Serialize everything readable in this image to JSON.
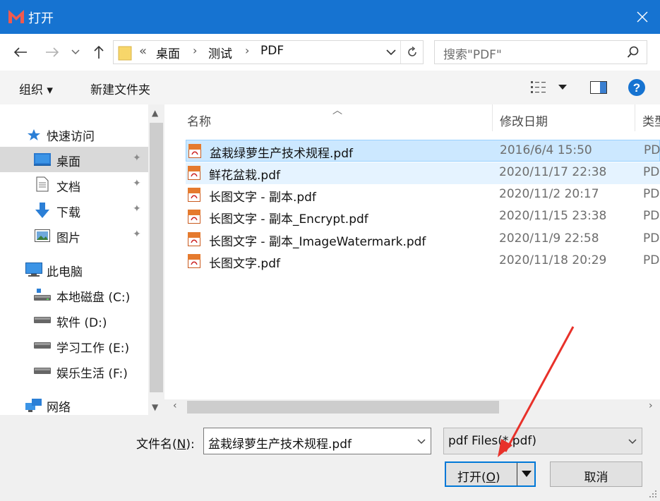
{
  "window": {
    "title": "打开",
    "close_icon": "close-icon"
  },
  "nav": {
    "back_icon": "arrow-left-icon",
    "forward_icon": "arrow-right-icon",
    "recent_icon": "chevron-down-icon",
    "up_icon": "arrow-up-icon",
    "overflow": "«",
    "breadcrumbs": [
      "桌面",
      "测试",
      "PDF"
    ],
    "refresh_icon": "refresh-icon",
    "search_placeholder": "搜索\"PDF\""
  },
  "toolbar": {
    "organize_label": "组织 ▾",
    "new_folder_label": "新建文件夹",
    "view_icon": "view-list-icon",
    "preview_icon": "preview-pane-icon",
    "help_icon": "help-icon"
  },
  "sidebar": {
    "items": [
      {
        "label": "快速访问",
        "icon": "star-icon"
      },
      {
        "label": "桌面",
        "icon": "desktop-icon",
        "pinned": true,
        "selected": true
      },
      {
        "label": "文档",
        "icon": "document-icon",
        "pinned": true
      },
      {
        "label": "下载",
        "icon": "download-icon",
        "pinned": true
      },
      {
        "label": "图片",
        "icon": "picture-icon",
        "pinned": true
      },
      {
        "label": "此电脑",
        "icon": "computer-icon"
      },
      {
        "label": "本地磁盘 (C:)",
        "icon": "drive-c-icon"
      },
      {
        "label": "软件 (D:)",
        "icon": "drive-icon"
      },
      {
        "label": "学习工作 (E:)",
        "icon": "drive-icon"
      },
      {
        "label": "娱乐生活 (F:)",
        "icon": "drive-icon"
      },
      {
        "label": "网络",
        "icon": "network-icon"
      }
    ]
  },
  "files": {
    "columns": [
      "名称",
      "修改日期",
      "类型"
    ],
    "rows": [
      {
        "name": "盆栽绿萝生产技术规程.pdf",
        "date": "2016/6/4 15:50",
        "type": "PD"
      },
      {
        "name": "鲜花盆栽.pdf",
        "date": "2020/11/17 22:38",
        "type": "PD"
      },
      {
        "name": "长图文字 - 副本.pdf",
        "date": "2020/11/2 20:17",
        "type": "PD"
      },
      {
        "name": "长图文字 - 副本_Encrypt.pdf",
        "date": "2020/11/15 23:38",
        "type": "PD"
      },
      {
        "name": "长图文字 - 副本_ImageWatermark.pdf",
        "date": "2020/11/9 22:58",
        "type": "PD"
      },
      {
        "name": "长图文字.pdf",
        "date": "2020/11/18 20:29",
        "type": "PD"
      }
    ]
  },
  "footer": {
    "filename_label_pre": "文件名(",
    "filename_label_key": "N",
    "filename_label_post": "):",
    "filename_value": "盆栽绿萝生产技术规程.pdf",
    "filetype_value": "pdf Files(*.pdf)",
    "open_label_pre": "打开(",
    "open_label_key": "O",
    "open_label_post": ")",
    "cancel_label": "取消"
  },
  "colors": {
    "titlebar": "#1673d1",
    "selection": "#cce8ff",
    "annotation": "#e8312a"
  }
}
